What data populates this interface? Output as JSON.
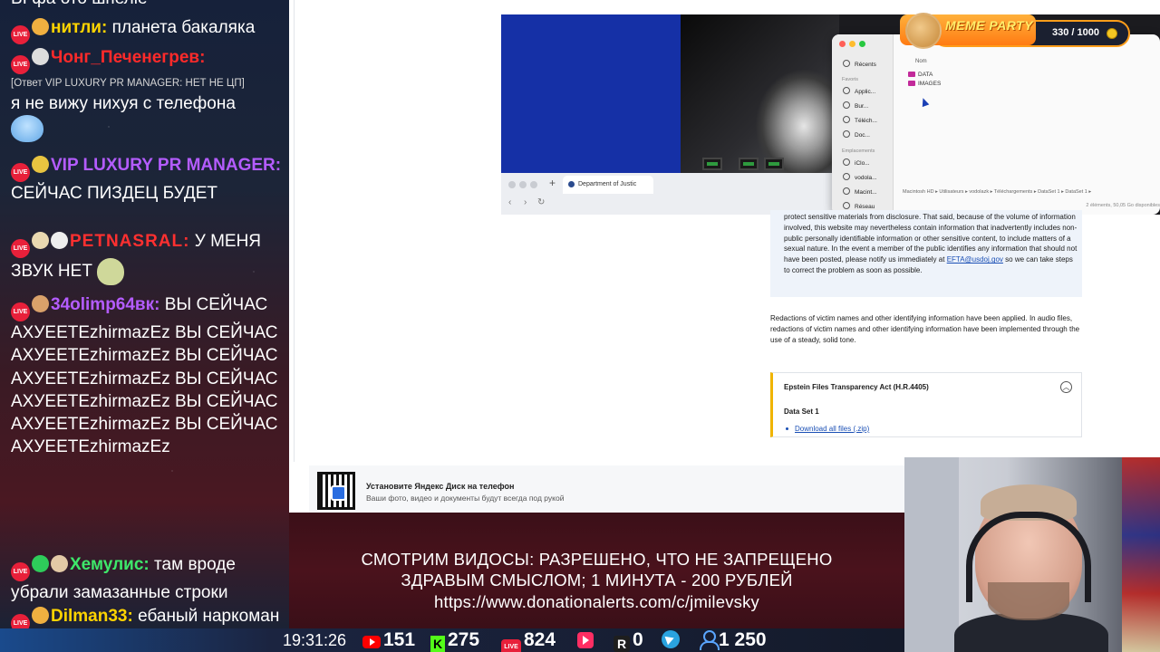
{
  "chat": {
    "top_fragment": "ВІ фа ото шпеліе",
    "messages": [
      {
        "nick": "нитли:",
        "nick_color": "#ffd400",
        "text": "планета бакаляка"
      },
      {
        "nick": "Чонг_Печенегрев:",
        "nick_color": "#ff2a2a",
        "reply": "[Ответ VIP LUXURY PR MANAGER: НЕТ НЕ ЦП]",
        "text": "я не вижу нихуя с телефона"
      },
      {
        "nick": "VIP LUXURY PR MANAGER:",
        "nick_color": "#b45cff",
        "text": "СЕЙЧАС ПИЗДЕЦ БУДЕТ"
      },
      {
        "nick": "PETNASRAL:",
        "nick_color": "#ff3030",
        "text": "У МЕНЯ ЗВУК НЕТ"
      },
      {
        "nick": "34olimp64вк:",
        "nick_color": "#b45cff",
        "text": "ВЫ СЕЙЧАС АХУЕЕТEzhirmazEz ВЫ СЕЙЧАС АХУЕЕТEzhirmazEz ВЫ СЕЙЧАС АХУЕЕТEzhirmazEz ВЫ СЕЙЧАС АХУЕЕТEzhirmazEz ВЫ СЕЙЧАС АХУЕЕТEzhirmazEz ВЫ СЕЙЧАС АХУЕЕТEzhirmazEz"
      },
      {
        "nick": "Хемулис:",
        "nick_color": "#3ee86a",
        "text": "там вроде убрали замазанные строки"
      },
      {
        "nick": "Dilman33:",
        "nick_color": "#ffd400",
        "text": "ебаный наркоман сука"
      }
    ],
    "live_badge": "LIVE"
  },
  "browser": {
    "tab_title": "Department of Justic",
    "finder": {
      "sidebar_recents": "Récents",
      "sidebar_favoris": "Favoris",
      "sidebar_items": [
        "Applic...",
        "Bur...",
        "Téléch...",
        "Doc..."
      ],
      "sidebar_emplacements": "Emplacements",
      "sidebar_locations": [
        "iClo...",
        "vodola...",
        "Macint...",
        "Réseau"
      ],
      "column_header": "Nom",
      "folders": [
        "DATA",
        "IMAGES"
      ],
      "path": "Macintosh HD ▸ Utilisateurs ▸ vodolazk ▸ Téléchargements ▸ DataSet 1 ▸ DataSet 1 ▸",
      "count": "2 éléments, 50,05 Go disponibles"
    },
    "meme_party": {
      "title": "MEME PARTY",
      "score": "330 / 1000"
    },
    "notice_text": "protect sensitive materials from disclosure. That said, because of the volume of information involved, this website may nevertheless contain information that inadvertently includes non-public personally identifiable information or other sensitive content, to include matters of a sexual nature. In the event a member of the public identifies any information that should not have been posted, please notify us immediately at",
    "notice_email": "EFTA@usdoj.gov",
    "notice_tail": "so we can take steps to correct the problem as soon as possible.",
    "redaction_text": "Redactions of victim names and other identifying information have been applied. In audio files, redactions of victim names and other identifying information have been implemented through the use of a steady, solid tone.",
    "accordion": {
      "title": "Epstein Files Transparency Act (H.R.4405)",
      "dataset": "Data Set 1",
      "download": "Download all files (.zip)"
    }
  },
  "yandex": {
    "title": "Установите Яндекс Диск на телефон",
    "subtitle": "Ваши фото, видео и документы будут всегда под рукой"
  },
  "rules": {
    "line1": "СМОТРИМ ВИДОСЫ: РАЗРЕШЕНО, ЧТО НЕ ЗАПРЕЩЕНО",
    "line2": "ЗДРАВЫМ СМЫСЛОМ; 1 МИНУТА - 200 РУБЛЕЙ",
    "line3": "https://www.donationalerts.com/c/jmilevsky"
  },
  "stats": {
    "clock": "19:31:26",
    "youtube": "151",
    "kick": "275",
    "vklive": "824",
    "vkvideo": "",
    "rutube": "0",
    "telegram": "",
    "viewers": "1 250",
    "kick_letter": "K",
    "rutube_letter": "R",
    "live_label": "LIVE"
  }
}
